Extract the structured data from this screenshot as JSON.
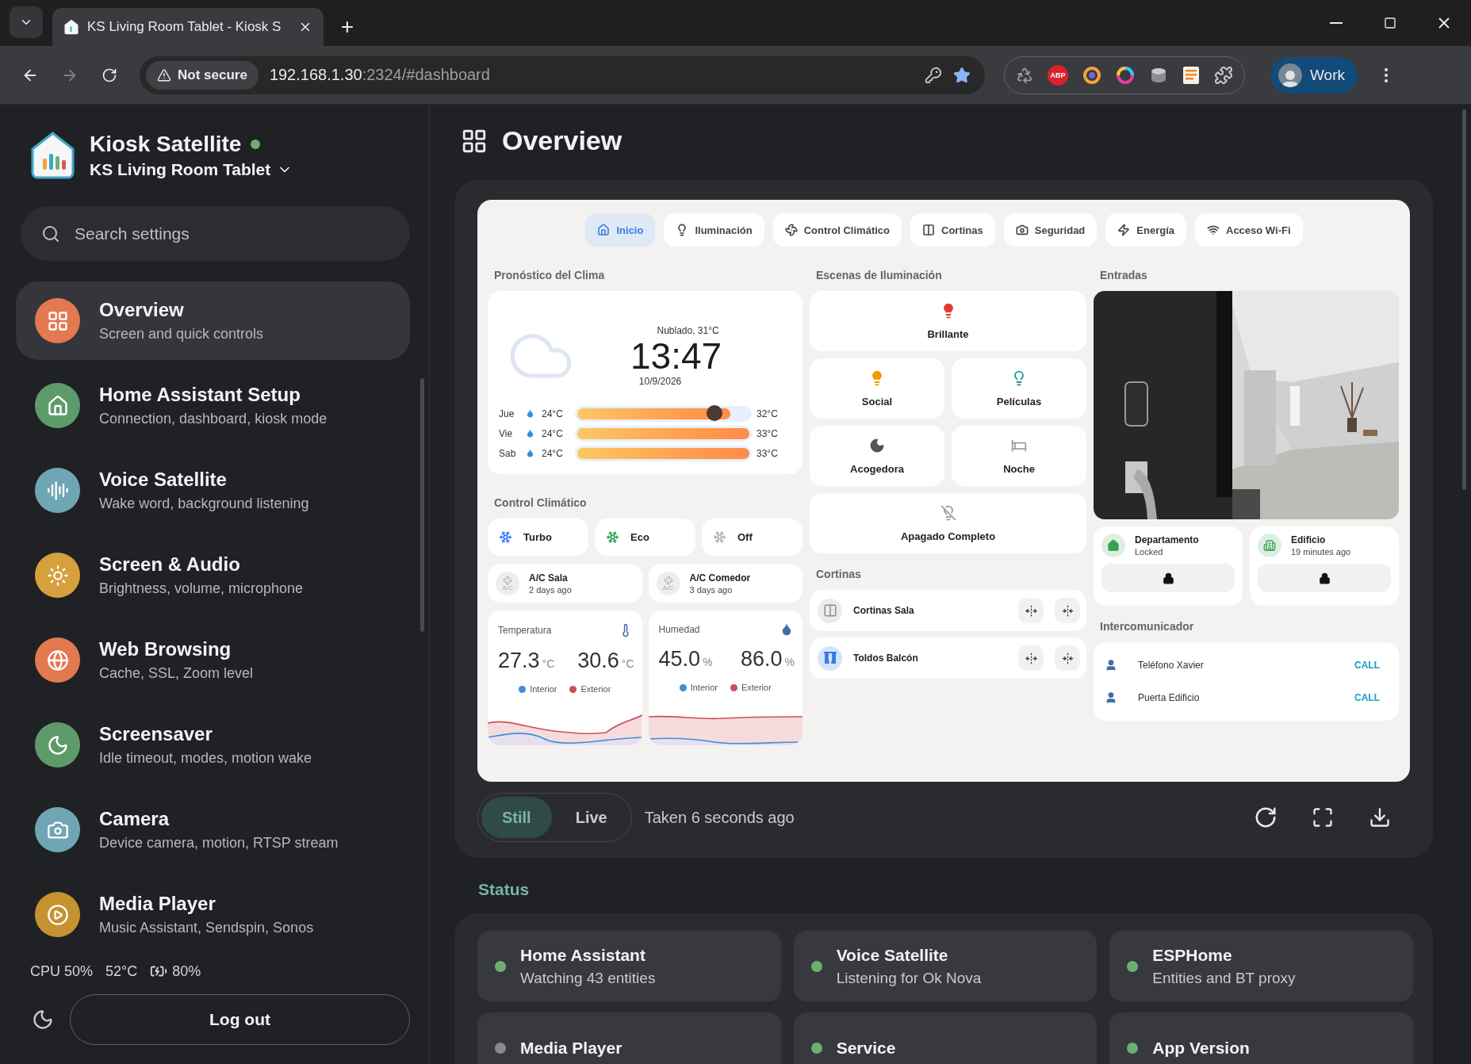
{
  "browser": {
    "tab": {
      "title": "KS Living Room Tablet - Kiosk S"
    },
    "new_tab": "+",
    "security": "Not secure",
    "url_host": "192.168.1.30",
    "url_rest": ":2324/#dashboard",
    "extensions": [
      {
        "kind": "recycle"
      },
      {
        "kind": "abp",
        "label": "ABP"
      },
      {
        "kind": "ring"
      },
      {
        "kind": "color"
      },
      {
        "kind": "disk"
      },
      {
        "kind": "doc"
      },
      {
        "kind": "puzzle"
      }
    ],
    "profile": "Work"
  },
  "sidebar": {
    "app_name": "Kiosk Satellite",
    "online": true,
    "device": "KS Living Room Tablet",
    "search": {
      "placeholder": "Search settings"
    },
    "items": [
      {
        "kind": "grid",
        "title": "Overview",
        "subtitle": "Screen and quick controls",
        "color": "#e27950",
        "selected": true
      },
      {
        "kind": "home",
        "title": "Home Assistant Setup",
        "subtitle": "Connection, dashboard, kiosk mode",
        "color": "#5e9b6b",
        "selected": false
      },
      {
        "kind": "voice",
        "title": "Voice Satellite",
        "subtitle": "Wake word, background listening",
        "color": "#6fa6b3",
        "selected": false
      },
      {
        "kind": "sun",
        "title": "Screen & Audio",
        "subtitle": "Brightness, volume, microphone",
        "color": "#d6a03c",
        "selected": false
      },
      {
        "kind": "globe",
        "title": "Web Browsing",
        "subtitle": "Cache, SSL, Zoom level",
        "color": "#e27950",
        "selected": false
      },
      {
        "kind": "moon",
        "title": "Screensaver",
        "subtitle": "Idle timeout, modes, motion wake",
        "color": "#5e9b6b",
        "selected": false
      },
      {
        "kind": "camera",
        "title": "Camera",
        "subtitle": "Device camera, motion, RTSP stream",
        "color": "#6fa6b3",
        "selected": false
      },
      {
        "kind": "play",
        "title": "Media Player",
        "subtitle": "Music Assistant, Sendspin, Sonos",
        "color": "#c4932f",
        "selected": false
      }
    ],
    "stats": {
      "cpu": "CPU 50%",
      "temp": "52°C",
      "battery": "80%"
    },
    "logout": "Log out"
  },
  "main": {
    "title": "Overview",
    "dashboard": {
      "tabs": [
        {
          "kind": "home",
          "label": "Inicio",
          "selected": true
        },
        {
          "kind": "bulb",
          "label": "Iluminación",
          "selected": false
        },
        {
          "kind": "fan",
          "label": "Control Climático",
          "selected": false
        },
        {
          "kind": "curtain",
          "label": "Cortinas",
          "selected": false
        },
        {
          "kind": "camera",
          "label": "Seguridad",
          "selected": false
        },
        {
          "kind": "bolt",
          "label": "Energía",
          "selected": false
        },
        {
          "kind": "wifi",
          "label": "Acceso Wi-Fi",
          "selected": false
        }
      ],
      "weather": {
        "title": "Pronóstico del Clima",
        "condition": "Nublado, 31°C",
        "time": "13:47",
        "date": "10/9/2026",
        "forecast": [
          {
            "day": "Jue",
            "low": "24°C",
            "high": "32°C",
            "level": 0.89,
            "now": {
              "level": 0.79
            }
          },
          {
            "day": "Vie",
            "low": "24°C",
            "high": "33°C",
            "level": 1
          },
          {
            "day": "Sab",
            "low": "24°C",
            "high": "33°C",
            "level": 1
          }
        ]
      },
      "climate": {
        "title": "Control Climático",
        "modes": [
          {
            "label": "Turbo",
            "color": "#3b82f6"
          },
          {
            "label": "Eco",
            "color": "#2ea85a"
          },
          {
            "label": "Off",
            "color": "#b4b4b4"
          }
        ],
        "units": [
          {
            "name": "A/C Sala",
            "badge": "A/C",
            "when": "2 days ago"
          },
          {
            "name": "A/C Comedor",
            "badge": "A/C",
            "when": "3 days ago"
          }
        ],
        "sensors": [
          {
            "kind": "temperature",
            "title": "Temperatura",
            "interior": "27.3",
            "interior_unit": "°C",
            "exterior": "30.6",
            "exterior_unit": "°C",
            "legend": [
              "Interior",
              "Exterior"
            ]
          },
          {
            "kind": "humidity",
            "title": "Humedad",
            "interior": "45.0",
            "interior_unit": "%",
            "exterior": "86.0",
            "exterior_unit": "%",
            "legend": [
              "Interior",
              "Exterior"
            ]
          }
        ]
      },
      "scenes": {
        "title": "Escenas de Iluminación",
        "items": [
          {
            "kind": "bright",
            "label": "Brillante",
            "color": "#e53935",
            "wide": true
          },
          {
            "kind": "social",
            "label": "Social",
            "color": "#f29900",
            "wide": false
          },
          {
            "kind": "movies",
            "label": "Películas",
            "color": "#12998a",
            "wide": false
          },
          {
            "kind": "cozy",
            "label": "Acogedora",
            "color": "#555555",
            "wide": false
          },
          {
            "kind": "night",
            "label": "Noche",
            "color": "#9aa0a6",
            "wide": false
          },
          {
            "kind": "off",
            "label": "Apagado Completo",
            "color": "#9aa0a6",
            "wide": true
          }
        ]
      },
      "curtains": {
        "title": "Cortinas",
        "items": [
          {
            "kind": "panels",
            "name": "Cortinas Sala",
            "active": false
          },
          {
            "kind": "drapes",
            "name": "Toldos Balcón",
            "active": true
          }
        ]
      },
      "entries": {
        "title": "Entradas",
        "locks": [
          {
            "kind": "home",
            "name": "Departamento",
            "status": "Locked"
          },
          {
            "kind": "building",
            "name": "Edificio",
            "status": "19 minutes ago"
          }
        ]
      },
      "intercom": {
        "title": "Intercomunicador",
        "contacts": [
          {
            "name": "Teléfono Xavier",
            "action": "CALL"
          },
          {
            "name": "Puerta Edificio",
            "action": "CALL"
          }
        ]
      }
    },
    "modes": [
      {
        "label": "Still",
        "selected": true
      },
      {
        "label": "Live",
        "selected": false
      }
    ],
    "taken": "Taken 6 seconds ago",
    "status": {
      "title": "Status",
      "cards": [
        {
          "title": "Home Assistant",
          "subtitle": "Watching 43 entities",
          "active": true
        },
        {
          "title": "Voice Satellite",
          "subtitle": "Listening for Ok Nova",
          "active": true
        },
        {
          "title": "ESPHome",
          "subtitle": "Entities and BT proxy",
          "active": true
        },
        {
          "title": "Media Player",
          "active": false
        },
        {
          "title": "Service",
          "active": true
        },
        {
          "title": "App Version",
          "active": true
        }
      ]
    }
  }
}
